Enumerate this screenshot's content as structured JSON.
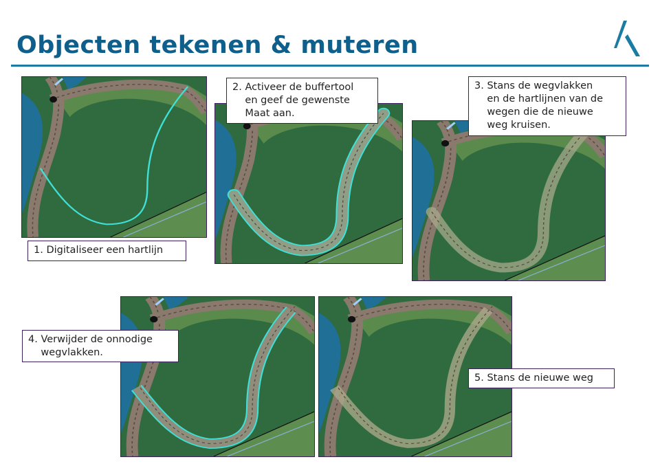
{
  "slide": {
    "title": "Objecten tekenen & muteren",
    "logo": "stylized-A-logo",
    "accent_color": "#0f5f8c"
  },
  "steps": [
    {
      "label": "1. Digitaliseer een hartlijn"
    },
    {
      "label": "2. Activeer de buffertool\n    en geef de gewenste\n    Maat aan."
    },
    {
      "label": "3. Stans de wegvlakken\n    en de hartlijnen van de\n    wegen die de nieuwe\n    weg kruisen."
    },
    {
      "label": "4. Verwijder de onnodige\n    wegvlakken."
    },
    {
      "label": "5. Stans de nieuwe weg"
    }
  ],
  "map_colors": {
    "forest": "#2f6b3f",
    "water": "#1f6f96",
    "road": "#8a7a6e",
    "field": "#7ea55a",
    "line": "#3fe0d8"
  }
}
